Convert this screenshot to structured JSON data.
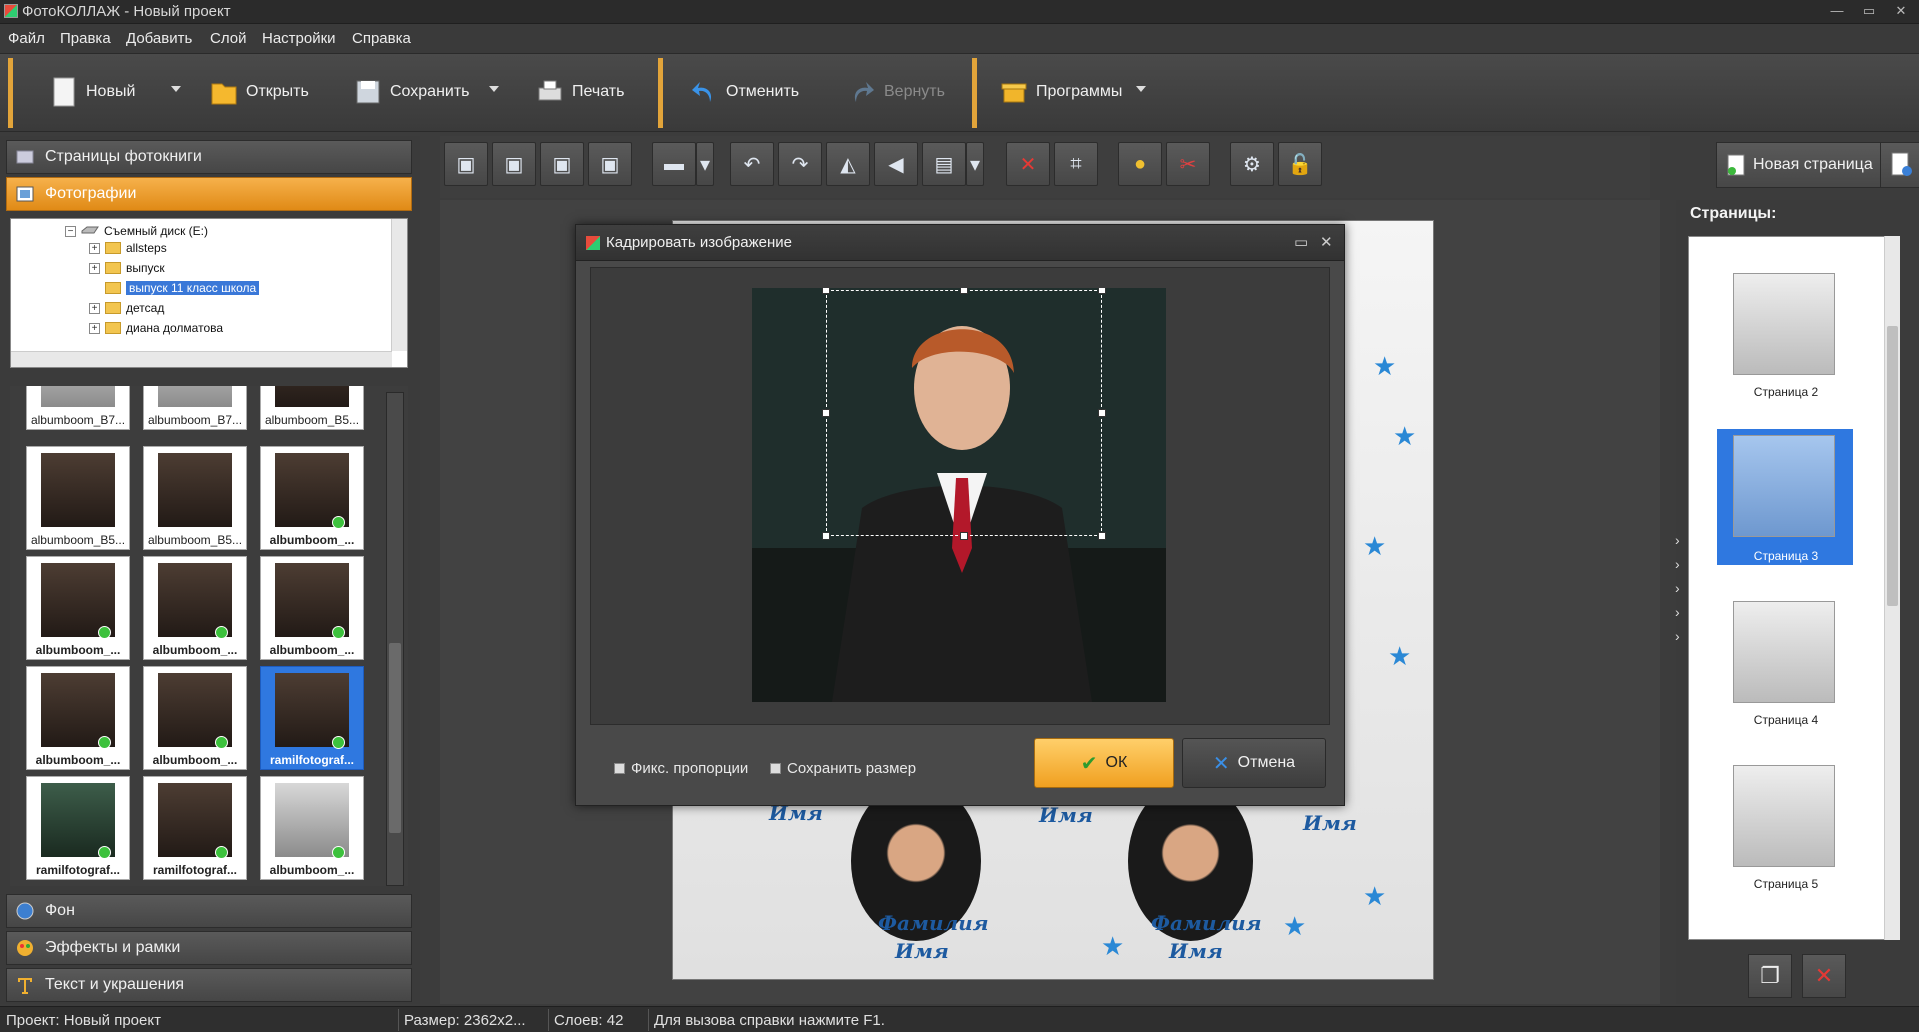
{
  "window": {
    "title": "ФотоКОЛЛАЖ - Новый проект"
  },
  "menu": [
    "Файл",
    "Правка",
    "Добавить",
    "Слой",
    "Настройки",
    "Справка"
  ],
  "toolbar": {
    "new": "Новый",
    "open": "Открыть",
    "save": "Сохранить",
    "print": "Печать",
    "undo": "Отменить",
    "redo": "Вернуть",
    "programs": "Программы"
  },
  "left": {
    "pages": "Страницы фотокниги",
    "photos": "Фотографии",
    "background": "Фон",
    "effects": "Эффекты и рамки",
    "text": "Текст и украшения"
  },
  "tree": [
    {
      "label": "Съемный диск (E:)"
    },
    {
      "label": "allsteps"
    },
    {
      "label": "выпуск"
    },
    {
      "label": "выпуск 11 класс школа",
      "selected": true
    },
    {
      "label": "детсад"
    },
    {
      "label": "диана долматова"
    }
  ],
  "thumbs": [
    [
      "albumboom_B7...",
      "albumboom_B7...",
      "albumboom_B5..."
    ],
    [
      "albumboom_B5...",
      "albumboom_B5...",
      "albumboom_..."
    ],
    [
      "albumboom_...",
      "albumboom_...",
      "albumboom_..."
    ],
    [
      "albumboom_...",
      "albumboom_...",
      "ramilfotograf..."
    ],
    [
      "ramilfotograf...",
      "ramilfotograf...",
      "albumboom_..."
    ]
  ],
  "newpage": "Новая страница",
  "canvas": {
    "name_label": "Имя",
    "surname_label": "Фамилия"
  },
  "right": {
    "title": "Страницы:",
    "pages": [
      "Страница 2",
      "Страница 3",
      "Страница 4",
      "Страница 5"
    ]
  },
  "dialog": {
    "title": "Кадрировать изображение",
    "fix": "Фикс. пропорции",
    "keep": "Сохранить размер",
    "ok": "ОК",
    "cancel": "Отмена"
  },
  "status": {
    "project": "Проект:  Новый проект",
    "size": "Размер:  2362x2...",
    "layers": "Слоев:  42",
    "help": "Для вызова справки нажмите F1."
  },
  "colors": {
    "accent": "#e2a43a",
    "selection": "#2f78e0",
    "ok": "#f0a020"
  }
}
